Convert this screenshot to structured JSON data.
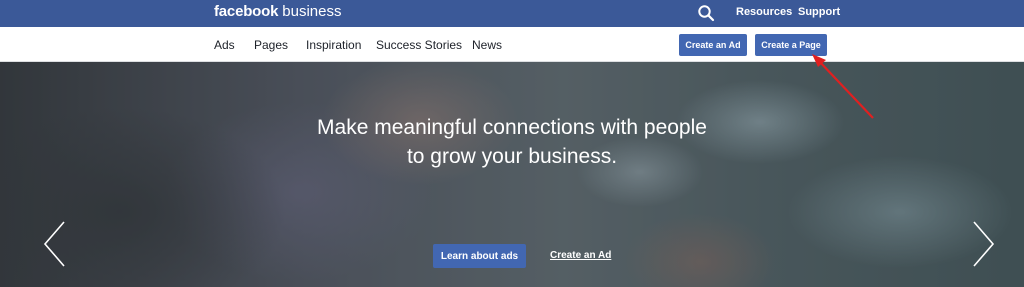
{
  "topbar": {
    "brand_bold": "facebook",
    "brand_light": "business",
    "resources": "Resources",
    "support": "Support"
  },
  "nav": {
    "items": [
      "Ads",
      "Pages",
      "Inspiration",
      "Success Stories",
      "News"
    ],
    "create_ad": "Create an Ad",
    "create_page": "Create a Page"
  },
  "hero": {
    "title_line1": "Make meaningful connections with people",
    "title_line2": "to grow your business.",
    "primary_cta": "Learn about ads",
    "secondary_cta": "Create an Ad"
  },
  "icons": {
    "search": "search-icon",
    "prev": "chevron-left-icon",
    "next": "chevron-right-icon"
  },
  "colors": {
    "topbar": "#3b5998",
    "button": "#4267b2",
    "annotation_arrow": "#e02020"
  }
}
